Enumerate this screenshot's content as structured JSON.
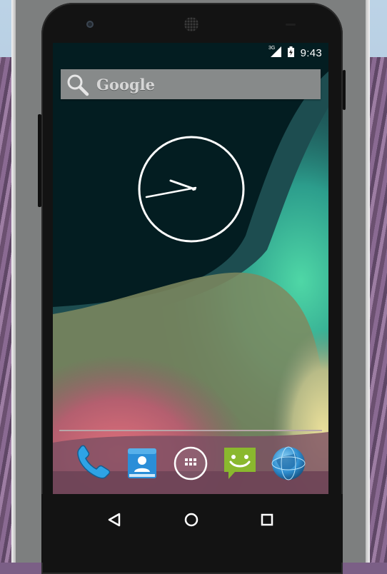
{
  "status_bar": {
    "network_type": "3G",
    "time": "9:43",
    "icons": [
      "signal-icon",
      "battery-icon"
    ]
  },
  "search_widget": {
    "label": "Google",
    "icon": "search-icon"
  },
  "clock_widget": {
    "type": "analog",
    "time": "9:43"
  },
  "hotseat": [
    {
      "name": "phone",
      "icon": "phone-icon",
      "color": "#2ea3e6"
    },
    {
      "name": "contacts",
      "icon": "contacts-icon",
      "color": "#2a8ed8"
    },
    {
      "name": "all-apps",
      "icon": "app-drawer-icon",
      "color": "#ffffff"
    },
    {
      "name": "messaging",
      "icon": "messaging-icon",
      "color": "#8ab82e"
    },
    {
      "name": "browser",
      "icon": "globe-icon",
      "color": "#2f8ed0"
    }
  ],
  "navigation": [
    "back-icon",
    "home-icon",
    "recents-icon"
  ],
  "colors": {
    "wallpaper_dark": "#031d21",
    "accent_teal": "#3fbd9c",
    "accent_pink": "#c55a6c",
    "accent_yellow": "#d4cf8f"
  }
}
